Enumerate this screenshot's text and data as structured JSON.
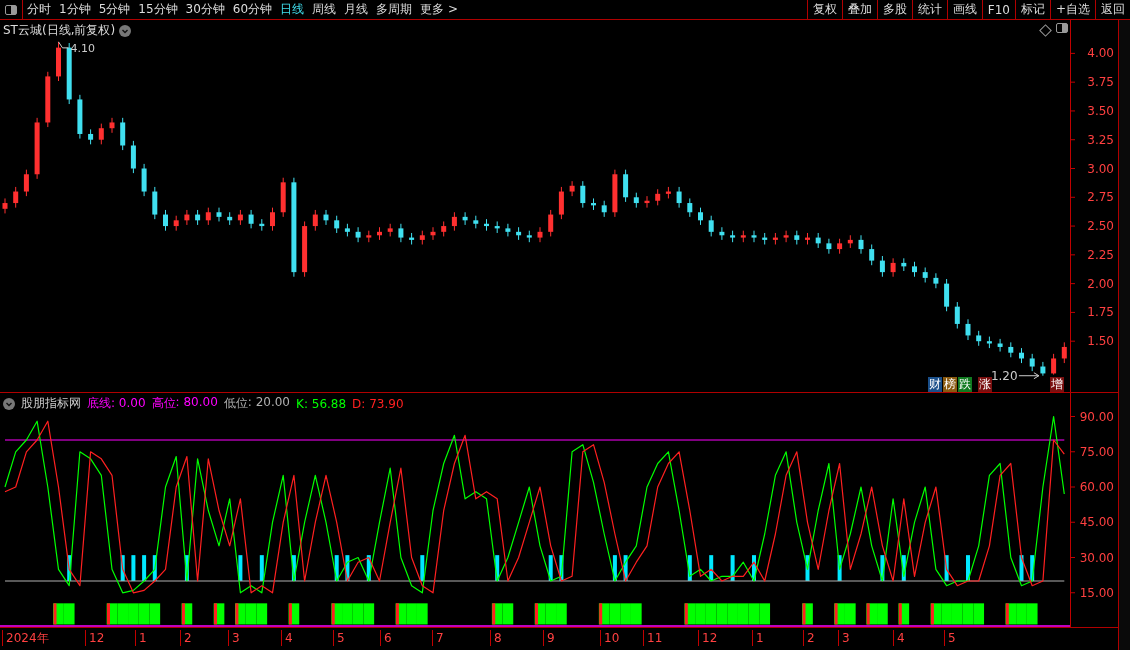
{
  "toolbar": {
    "periods": [
      {
        "label": "分时",
        "selected": false
      },
      {
        "label": "1分钟",
        "selected": false
      },
      {
        "label": "5分钟",
        "selected": false
      },
      {
        "label": "15分钟",
        "selected": false
      },
      {
        "label": "30分钟",
        "selected": false
      },
      {
        "label": "60分钟",
        "selected": false
      },
      {
        "label": "日线",
        "selected": true
      },
      {
        "label": "周线",
        "selected": false
      },
      {
        "label": "月线",
        "selected": false
      },
      {
        "label": "多周期",
        "selected": false
      },
      {
        "label": "更多 >",
        "selected": false
      }
    ],
    "actions": [
      "复权",
      "叠加",
      "多股",
      "统计",
      "画线",
      "F10",
      "标记",
      "+自选",
      "返回"
    ]
  },
  "price_panel": {
    "title": "ST云城(日线,前复权)",
    "badges": [
      {
        "text": "财",
        "color": "#1a4f8a"
      },
      {
        "text": "榜",
        "color": "#8a5a10"
      },
      {
        "text": "跌",
        "color": "#107a20"
      },
      {
        "text": "涨",
        "color": "#7a1010"
      },
      {
        "text": "增",
        "color": "#7a1010"
      }
    ],
    "chart_data": {
      "type": "candlestick",
      "ylim": [
        1.05,
        4.29
      ],
      "yticks": [
        {
          "value": 4.0,
          "label": "4.00"
        },
        {
          "value": 3.75,
          "label": "3.75"
        },
        {
          "value": 3.5,
          "label": "3.50"
        },
        {
          "value": 3.25,
          "label": "3.25"
        },
        {
          "value": 3.0,
          "label": "3.00"
        },
        {
          "value": 2.75,
          "label": "2.75"
        },
        {
          "value": 2.5,
          "label": "2.50"
        },
        {
          "value": 2.25,
          "label": "2.25"
        },
        {
          "value": 2.0,
          "label": "2.00"
        },
        {
          "value": 1.75,
          "label": "1.75"
        },
        {
          "value": 1.5,
          "label": "1.50"
        }
      ],
      "ohlc": [
        [
          2.65,
          2.74,
          2.61,
          2.7
        ],
        [
          2.7,
          2.84,
          2.66,
          2.8
        ],
        [
          2.8,
          2.99,
          2.76,
          2.95
        ],
        [
          2.95,
          3.44,
          2.91,
          3.4
        ],
        [
          3.4,
          3.84,
          3.36,
          3.8
        ],
        [
          3.8,
          4.1,
          3.76,
          4.05
        ],
        [
          4.05,
          4.09,
          3.56,
          3.6
        ],
        [
          3.6,
          3.64,
          3.26,
          3.3
        ],
        [
          3.3,
          3.34,
          3.21,
          3.25
        ],
        [
          3.25,
          3.39,
          3.21,
          3.35
        ],
        [
          3.35,
          3.44,
          3.31,
          3.4
        ],
        [
          3.4,
          3.44,
          3.16,
          3.2
        ],
        [
          3.2,
          3.24,
          2.96,
          3.0
        ],
        [
          3.0,
          3.04,
          2.76,
          2.8
        ],
        [
          2.8,
          2.84,
          2.56,
          2.6
        ],
        [
          2.6,
          2.64,
          2.46,
          2.5
        ],
        [
          2.5,
          2.59,
          2.46,
          2.55
        ],
        [
          2.55,
          2.64,
          2.51,
          2.6
        ],
        [
          2.6,
          2.64,
          2.51,
          2.55
        ],
        [
          2.55,
          2.66,
          2.51,
          2.62
        ],
        [
          2.62,
          2.66,
          2.54,
          2.58
        ],
        [
          2.58,
          2.62,
          2.51,
          2.55
        ],
        [
          2.55,
          2.64,
          2.51,
          2.6
        ],
        [
          2.6,
          2.64,
          2.48,
          2.52
        ],
        [
          2.52,
          2.56,
          2.46,
          2.5
        ],
        [
          2.5,
          2.66,
          2.46,
          2.62
        ],
        [
          2.62,
          2.92,
          2.58,
          2.88
        ],
        [
          2.88,
          2.92,
          2.06,
          2.1
        ],
        [
          2.1,
          2.54,
          2.06,
          2.5
        ],
        [
          2.5,
          2.64,
          2.46,
          2.6
        ],
        [
          2.6,
          2.64,
          2.51,
          2.55
        ],
        [
          2.55,
          2.59,
          2.44,
          2.48
        ],
        [
          2.48,
          2.52,
          2.41,
          2.45
        ],
        [
          2.45,
          2.49,
          2.36,
          2.4
        ],
        [
          2.4,
          2.46,
          2.36,
          2.42
        ],
        [
          2.42,
          2.49,
          2.38,
          2.45
        ],
        [
          2.45,
          2.52,
          2.41,
          2.48
        ],
        [
          2.48,
          2.52,
          2.36,
          2.4
        ],
        [
          2.4,
          2.44,
          2.34,
          2.38
        ],
        [
          2.38,
          2.46,
          2.34,
          2.42
        ],
        [
          2.42,
          2.49,
          2.38,
          2.45
        ],
        [
          2.45,
          2.54,
          2.41,
          2.5
        ],
        [
          2.5,
          2.62,
          2.46,
          2.58
        ],
        [
          2.58,
          2.62,
          2.51,
          2.55
        ],
        [
          2.55,
          2.59,
          2.48,
          2.52
        ],
        [
          2.52,
          2.56,
          2.46,
          2.5
        ],
        [
          2.5,
          2.54,
          2.44,
          2.48
        ],
        [
          2.48,
          2.52,
          2.41,
          2.45
        ],
        [
          2.45,
          2.49,
          2.38,
          2.42
        ],
        [
          2.42,
          2.46,
          2.36,
          2.4
        ],
        [
          2.4,
          2.49,
          2.36,
          2.45
        ],
        [
          2.45,
          2.64,
          2.41,
          2.6
        ],
        [
          2.6,
          2.84,
          2.56,
          2.8
        ],
        [
          2.8,
          2.89,
          2.76,
          2.85
        ],
        [
          2.85,
          2.89,
          2.66,
          2.7
        ],
        [
          2.7,
          2.74,
          2.64,
          2.68
        ],
        [
          2.68,
          2.72,
          2.58,
          2.62
        ],
        [
          2.62,
          2.99,
          2.58,
          2.95
        ],
        [
          2.95,
          2.99,
          2.71,
          2.75
        ],
        [
          2.75,
          2.79,
          2.66,
          2.7
        ],
        [
          2.7,
          2.76,
          2.66,
          2.72
        ],
        [
          2.72,
          2.82,
          2.68,
          2.78
        ],
        [
          2.78,
          2.84,
          2.74,
          2.8
        ],
        [
          2.8,
          2.84,
          2.66,
          2.7
        ],
        [
          2.7,
          2.74,
          2.58,
          2.62
        ],
        [
          2.62,
          2.66,
          2.51,
          2.55
        ],
        [
          2.55,
          2.59,
          2.41,
          2.45
        ],
        [
          2.45,
          2.49,
          2.38,
          2.42
        ],
        [
          2.42,
          2.46,
          2.36,
          2.4
        ],
        [
          2.4,
          2.46,
          2.36,
          2.42
        ],
        [
          2.42,
          2.46,
          2.36,
          2.4
        ],
        [
          2.4,
          2.44,
          2.34,
          2.38
        ],
        [
          2.38,
          2.44,
          2.34,
          2.4
        ],
        [
          2.4,
          2.46,
          2.36,
          2.42
        ],
        [
          2.42,
          2.46,
          2.34,
          2.38
        ],
        [
          2.38,
          2.44,
          2.34,
          2.4
        ],
        [
          2.4,
          2.44,
          2.31,
          2.35
        ],
        [
          2.35,
          2.39,
          2.26,
          2.3
        ],
        [
          2.3,
          2.39,
          2.26,
          2.35
        ],
        [
          2.35,
          2.42,
          2.31,
          2.38
        ],
        [
          2.38,
          2.42,
          2.26,
          2.3
        ],
        [
          2.3,
          2.34,
          2.16,
          2.2
        ],
        [
          2.2,
          2.24,
          2.06,
          2.1
        ],
        [
          2.1,
          2.22,
          2.06,
          2.18
        ],
        [
          2.18,
          2.22,
          2.11,
          2.15
        ],
        [
          2.15,
          2.19,
          2.06,
          2.1
        ],
        [
          2.1,
          2.14,
          2.01,
          2.05
        ],
        [
          2.05,
          2.09,
          1.96,
          2.0
        ],
        [
          2.0,
          2.04,
          1.76,
          1.8
        ],
        [
          1.8,
          1.84,
          1.61,
          1.65
        ],
        [
          1.65,
          1.69,
          1.51,
          1.55
        ],
        [
          1.55,
          1.59,
          1.46,
          1.5
        ],
        [
          1.5,
          1.54,
          1.44,
          1.48
        ],
        [
          1.48,
          1.52,
          1.41,
          1.45
        ],
        [
          1.45,
          1.49,
          1.36,
          1.4
        ],
        [
          1.4,
          1.44,
          1.31,
          1.35
        ],
        [
          1.35,
          1.39,
          1.24,
          1.28
        ],
        [
          1.28,
          1.32,
          1.2,
          1.22
        ],
        [
          1.22,
          1.39,
          1.21,
          1.35
        ],
        [
          1.35,
          1.49,
          1.31,
          1.45
        ]
      ],
      "annotations": [
        "4.10",
        "1.20"
      ]
    }
  },
  "indicator_panel": {
    "name": "股朋指标网",
    "params": [
      {
        "label": "底线:",
        "value": "0.00",
        "color": "#ff00ff"
      }
    ],
    "legend": [
      ": 80.00",
      ": 20.00",
      ": 56.88",
      ": 73.90"
    ],
    "chart_data": {
      "type": "line",
      "ylim": [
        0,
        100
      ],
      "yticks": [
        {
          "value": 90,
          "label": "90.00"
        },
        {
          "value": 75,
          "label": "75.00"
        },
        {
          "value": 60,
          "label": "60.00"
        },
        {
          "value": 45,
          "label": "45.00"
        },
        {
          "value": 30,
          "label": "30.00"
        },
        {
          "value": 15,
          "label": "15.00"
        }
      ],
      "series": [
        {
          "name": "高位",
          "color": "#ff00ff",
          "values": [
            80,
            80,
            80,
            80,
            80,
            80,
            80,
            80,
            80,
            80,
            80,
            80,
            80,
            80,
            80,
            80,
            80,
            80,
            80,
            80,
            80,
            80,
            80,
            80,
            80,
            80,
            80,
            80,
            80,
            80,
            80,
            80,
            80,
            80,
            80,
            80,
            80,
            80,
            80,
            80,
            80,
            80,
            80,
            80,
            80,
            80,
            80,
            80,
            80,
            80,
            80,
            80,
            80,
            80,
            80,
            80,
            80,
            80,
            80,
            80,
            80,
            80,
            80,
            80,
            80,
            80,
            80,
            80,
            80,
            80,
            80,
            80,
            80,
            80,
            80,
            80,
            80,
            80,
            80,
            80,
            80,
            80,
            80,
            80,
            80,
            80,
            80,
            80,
            80,
            80,
            80,
            80,
            80,
            80,
            80,
            80,
            80,
            80,
            80,
            80
          ]
        },
        {
          "name": "低位",
          "color": "#b0b0b0",
          "values": [
            20,
            20,
            20,
            20,
            20,
            20,
            20,
            20,
            20,
            20,
            20,
            20,
            20,
            20,
            20,
            20,
            20,
            20,
            20,
            20,
            20,
            20,
            20,
            20,
            20,
            20,
            20,
            20,
            20,
            20,
            20,
            20,
            20,
            20,
            20,
            20,
            20,
            20,
            20,
            20,
            20,
            20,
            20,
            20,
            20,
            20,
            20,
            20,
            20,
            20,
            20,
            20,
            20,
            20,
            20,
            20,
            20,
            20,
            20,
            20,
            20,
            20,
            20,
            20,
            20,
            20,
            20,
            20,
            20,
            20,
            20,
            20,
            20,
            20,
            20,
            20,
            20,
            20,
            20,
            20,
            20,
            20,
            20,
            20,
            20,
            20,
            20,
            20,
            20,
            20,
            20,
            20,
            20,
            20,
            20,
            20,
            20,
            20,
            20,
            20
          ]
        },
        {
          "name": "K",
          "color": "#00ff00",
          "values": [
            60,
            75,
            80,
            88,
            60,
            25,
            18,
            75,
            72,
            65,
            25,
            15,
            16,
            20,
            25,
            60,
            73,
            20,
            72,
            50,
            35,
            55,
            15,
            18,
            15,
            45,
            65,
            20,
            45,
            65,
            45,
            20,
            28,
            30,
            20,
            45,
            68,
            30,
            18,
            15,
            50,
            70,
            82,
            55,
            58,
            55,
            20,
            30,
            45,
            60,
            35,
            20,
            22,
            75,
            78,
            62,
            40,
            20,
            28,
            35,
            60,
            70,
            75,
            50,
            22,
            25,
            20,
            22,
            22,
            28,
            20,
            40,
            65,
            75,
            45,
            25,
            50,
            70,
            25,
            40,
            60,
            35,
            20,
            55,
            22,
            45,
            60,
            25,
            18,
            20,
            20,
            35,
            65,
            70,
            30,
            18,
            20,
            60,
            90,
            57
          ]
        },
        {
          "name": "D",
          "color": "#ff2020",
          "values": [
            58,
            60,
            75,
            80,
            88,
            60,
            25,
            18,
            75,
            72,
            65,
            25,
            15,
            16,
            20,
            25,
            60,
            73,
            20,
            72,
            50,
            35,
            55,
            15,
            18,
            15,
            45,
            65,
            20,
            45,
            65,
            45,
            20,
            28,
            30,
            20,
            45,
            68,
            30,
            18,
            15,
            50,
            70,
            82,
            55,
            58,
            55,
            20,
            30,
            45,
            60,
            35,
            20,
            22,
            75,
            78,
            62,
            40,
            20,
            28,
            35,
            60,
            70,
            75,
            50,
            22,
            25,
            20,
            22,
            22,
            28,
            20,
            40,
            65,
            75,
            45,
            25,
            50,
            70,
            25,
            40,
            60,
            35,
            20,
            55,
            22,
            45,
            60,
            25,
            18,
            20,
            20,
            35,
            65,
            70,
            30,
            18,
            20,
            80,
            74
          ]
        }
      ]
    }
  },
  "x_axis": [
    "2024年",
    "12",
    "1",
    "2",
    "3",
    "4",
    "5",
    "6",
    "7",
    "8",
    "9",
    "10",
    "11",
    "12",
    "1",
    "2",
    "3",
    "4",
    "5"
  ]
}
